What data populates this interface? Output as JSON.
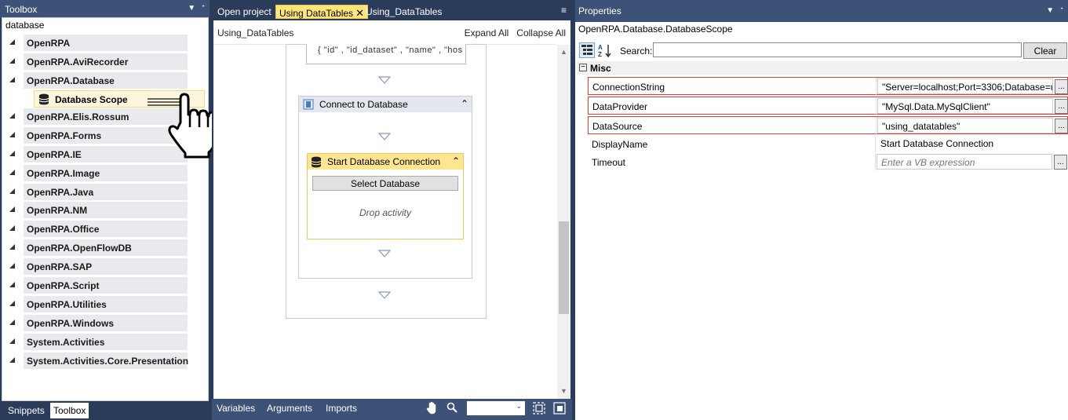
{
  "toolbox": {
    "title": "Toolbox",
    "search_value": "database",
    "categories": [
      {
        "label": "OpenRPA"
      },
      {
        "label": "OpenRPA.AviRecorder"
      },
      {
        "label": "OpenRPA.Database"
      },
      {
        "label": "OpenRPA.Elis.Rossum"
      },
      {
        "label": "OpenRPA.Forms"
      },
      {
        "label": "OpenRPA.IE"
      },
      {
        "label": "OpenRPA.Image"
      },
      {
        "label": "OpenRPA.Java"
      },
      {
        "label": "OpenRPA.NM"
      },
      {
        "label": "OpenRPA.Office"
      },
      {
        "label": "OpenRPA.OpenFlowDB"
      },
      {
        "label": "OpenRPA.SAP"
      },
      {
        "label": "OpenRPA.Script"
      },
      {
        "label": "OpenRPA.Utilities"
      },
      {
        "label": "OpenRPA.Windows"
      },
      {
        "label": "System.Activities"
      },
      {
        "label": "System.Activities.Core.Presentation"
      }
    ],
    "selected_item": "Database Scope",
    "bottom_tabs": [
      "Snippets",
      "Toolbox"
    ]
  },
  "designer": {
    "tabs": [
      {
        "label": "Open project"
      },
      {
        "label": "Using DataTables"
      },
      {
        "label": "Using_DataTables"
      }
    ],
    "breadcrumb": "Using_DataTables",
    "expand_all": "Expand All",
    "collapse_all": "Collapse All",
    "columns_text": "{ \"id\" , \"id_dataset\" , \"name\" , \"hos",
    "connect_title": "Connect to Database",
    "start_title": "Start Database Connection",
    "select_button": "Select Database",
    "drop_text": "Drop activity",
    "footer_tabs": [
      "Variables",
      "Arguments",
      "Imports"
    ]
  },
  "properties": {
    "title": "Properties",
    "type_name": "OpenRPA.Database.DatabaseScope",
    "search_label": "Search:",
    "search_value": "",
    "clear_label": "Clear",
    "category": "Misc",
    "rows": [
      {
        "name": "ConnectionString",
        "value": "\"Server=localhost;Port=3306;Database=u",
        "highlight": true
      },
      {
        "name": "DataProvider",
        "value": "\"MySql.Data.MySqlClient\"",
        "highlight": true
      },
      {
        "name": "DataSource",
        "value": "\"using_datatables\"",
        "highlight": true
      },
      {
        "name": "DisplayName",
        "value": "Start Database Connection",
        "highlight": false
      },
      {
        "name": "Timeout",
        "value": "Enter a VB expression",
        "highlight": false
      }
    ]
  },
  "colors": {
    "panel_dark": "#2b3c5a",
    "title_bar": "#3d5277",
    "active_tab": "#fde57a",
    "highlight_red": "#e53935"
  }
}
